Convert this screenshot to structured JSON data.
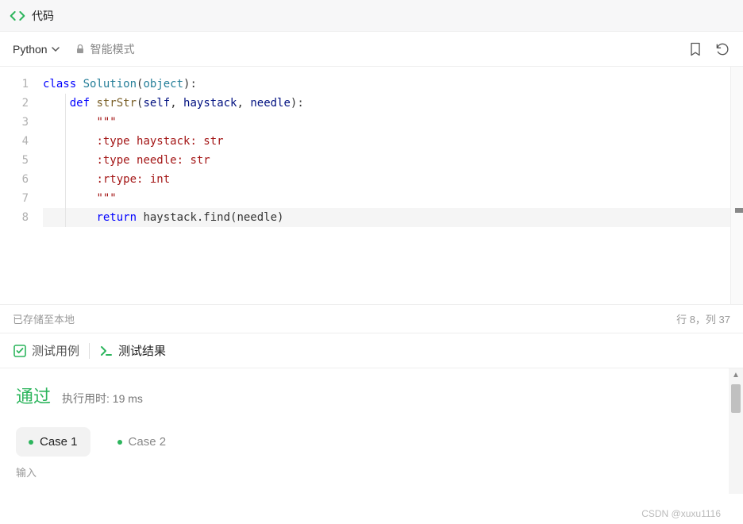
{
  "header": {
    "title": "代码"
  },
  "toolbar": {
    "language": "Python",
    "mode": "智能模式"
  },
  "editor": {
    "lines": [
      {
        "n": 1,
        "segments": [
          [
            "kw",
            "class"
          ],
          [
            "plain",
            " "
          ],
          [
            "cls",
            "Solution"
          ],
          [
            "plain",
            "("
          ],
          [
            "cls",
            "object"
          ],
          [
            "plain",
            "):"
          ]
        ]
      },
      {
        "n": 2,
        "segments": [
          [
            "plain",
            "    "
          ],
          [
            "kw",
            "def"
          ],
          [
            "plain",
            " "
          ],
          [
            "fn",
            "strStr"
          ],
          [
            "plain",
            "("
          ],
          [
            "param",
            "self"
          ],
          [
            "plain",
            ", "
          ],
          [
            "param",
            "haystack"
          ],
          [
            "plain",
            ", "
          ],
          [
            "param",
            "needle"
          ],
          [
            "plain",
            "):"
          ]
        ]
      },
      {
        "n": 3,
        "segments": [
          [
            "plain",
            "        "
          ],
          [
            "str",
            "\"\"\""
          ]
        ]
      },
      {
        "n": 4,
        "segments": [
          [
            "plain",
            "        "
          ],
          [
            "str",
            ":type haystack: str"
          ]
        ]
      },
      {
        "n": 5,
        "segments": [
          [
            "plain",
            "        "
          ],
          [
            "str",
            ":type needle: str"
          ]
        ]
      },
      {
        "n": 6,
        "segments": [
          [
            "plain",
            "        "
          ],
          [
            "str",
            ":rtype: int"
          ]
        ]
      },
      {
        "n": 7,
        "segments": [
          [
            "plain",
            "        "
          ],
          [
            "str",
            "\"\"\""
          ]
        ]
      },
      {
        "n": 8,
        "cursor": true,
        "segments": [
          [
            "plain",
            "        "
          ],
          [
            "kw",
            "return"
          ],
          [
            "plain",
            " haystack.find(needle)"
          ]
        ]
      }
    ]
  },
  "status": {
    "saved": "已存储至本地",
    "position": "行 8，列 37"
  },
  "results": {
    "tabs": {
      "test_cases": "测试用例",
      "test_results": "测试结果"
    },
    "pass": "通过",
    "time_label": "执行用时: 19 ms",
    "cases": [
      {
        "label": "Case 1",
        "active": true
      },
      {
        "label": "Case 2",
        "active": false
      }
    ],
    "input_label": "输入"
  },
  "watermark": "CSDN @xuxu1116"
}
